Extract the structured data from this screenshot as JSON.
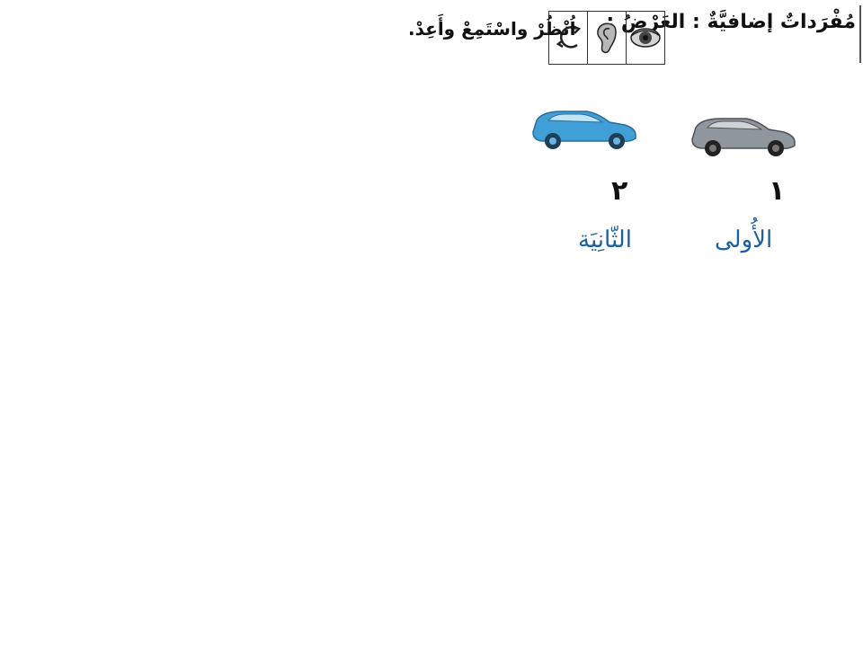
{
  "header": {
    "title": "مُفْرَداتٌ إضافيَّةٌ : العَرْضُ :",
    "instruction": "اُنْظُرْ واسْتَمِعْ وأَعِدْ.",
    "icons": [
      "eye-icon",
      "ear-icon",
      "repeat-icon"
    ]
  },
  "vehicles": [
    {
      "number": "١",
      "label": "الأُولى",
      "color": "#8f969d"
    },
    {
      "number": "٢",
      "label": "الثّانِيَة",
      "color": "#3f9fd6"
    }
  ]
}
